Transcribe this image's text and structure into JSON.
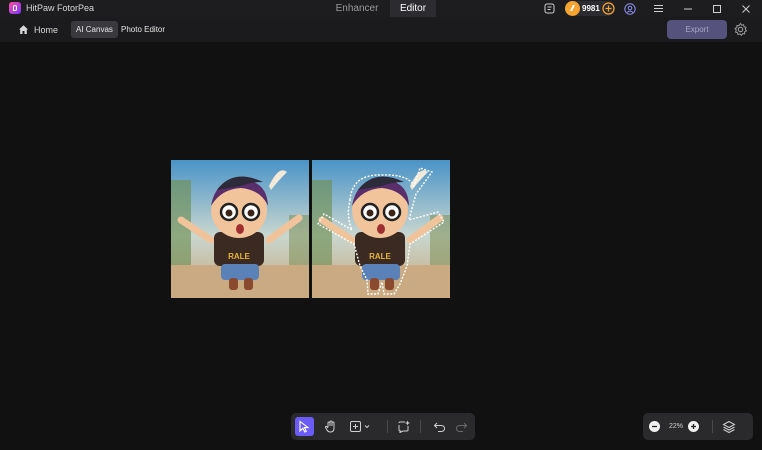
{
  "app": {
    "name": "HitPaw FotorPea"
  },
  "top_tabs": [
    {
      "label": "Enhancer"
    },
    {
      "label": "Editor"
    }
  ],
  "credits": {
    "count": "9981"
  },
  "nav": {
    "home_label": "Home",
    "tabs": [
      {
        "label": "AI Canvas"
      },
      {
        "label": "Photo Editor"
      }
    ],
    "export_label": "Export"
  },
  "zoom": {
    "level": "22%"
  },
  "colors": {
    "accent": "#6b5cf6",
    "export_disabled": "#55527d",
    "coin": "#f4a531"
  },
  "icons": [
    "chat-icon",
    "coin-icon",
    "plus-circle-icon",
    "user-icon",
    "menu-icon",
    "minimize-icon",
    "maximize-icon",
    "close-icon",
    "home-icon",
    "settings-icon",
    "select-icon",
    "hand-icon",
    "add-icon",
    "ai-icon",
    "undo-icon",
    "redo-icon",
    "zoom-out-icon",
    "zoom-in-icon",
    "layers-icon"
  ]
}
